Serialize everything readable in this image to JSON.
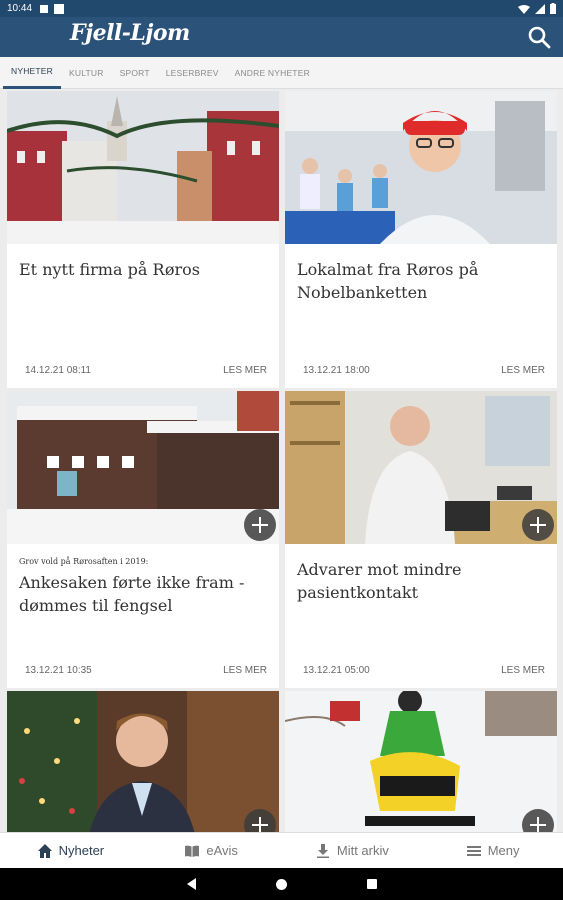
{
  "status": {
    "time": "10:44"
  },
  "app": {
    "logo": "Fjell-Ljom"
  },
  "tabs": [
    {
      "label": "NYHETER",
      "active": true
    },
    {
      "label": "KULTUR",
      "active": false
    },
    {
      "label": "SPORT",
      "active": false
    },
    {
      "label": "LESERBREV",
      "active": false
    },
    {
      "label": "ANDRE NYHETER",
      "active": false
    }
  ],
  "articles": [
    {
      "kicker": "",
      "title": "Et nytt firma på Røros",
      "date": "14.12.21 08:11",
      "more": "LES MER",
      "plus": false,
      "image": "snowy-street-christmas-lights"
    },
    {
      "kicker": "",
      "title": "Lokalmat fra Røros på Nobelbanketten",
      "date": "13.12.21 18:00",
      "more": "LES MER",
      "plus": false,
      "image": "food-factory-worker"
    },
    {
      "kicker": "Grov vold på Rørosaften i 2019:",
      "title": "Ankesaken førte ikke fram - dømmes til fengsel",
      "date": "13.12.21 10:35",
      "more": "LES MER",
      "plus": true,
      "image": "snowy-building-night"
    },
    {
      "kicker": "",
      "title": "Advarer mot mindre pasientkontakt",
      "date": "13.12.21 05:00",
      "more": "LES MER",
      "plus": true,
      "image": "doctor-office"
    },
    {
      "kicker": "",
      "title": "",
      "date": "",
      "more": "",
      "plus": true,
      "image": "man-christmas-tree"
    },
    {
      "kicker": "",
      "title": "",
      "date": "",
      "more": "",
      "plus": true,
      "image": "snowmobile-racers"
    }
  ],
  "bottomnav": [
    {
      "label": "Nyheter",
      "icon": "home-icon",
      "active": true
    },
    {
      "label": "eAvis",
      "icon": "book-icon",
      "active": false
    },
    {
      "label": "Mitt arkiv",
      "icon": "download-icon",
      "active": false
    },
    {
      "label": "Meny",
      "icon": "menu-icon",
      "active": false
    }
  ],
  "colors": {
    "header": "#2b5279",
    "statusbar": "#21486d",
    "text": "#333333"
  }
}
